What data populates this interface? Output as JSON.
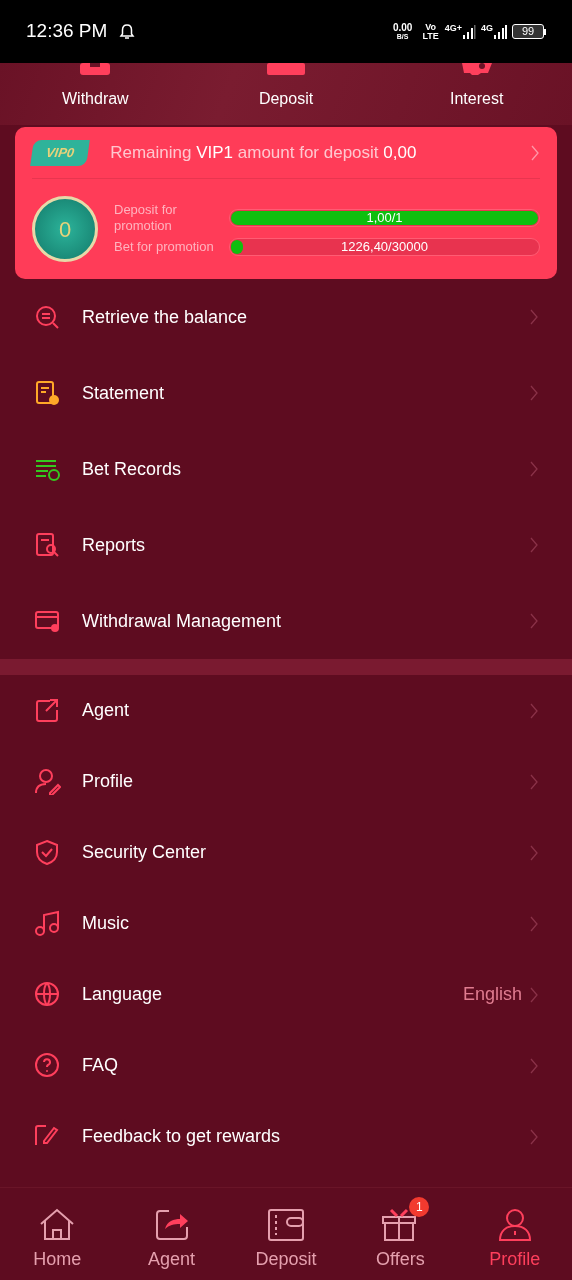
{
  "status_bar": {
    "time": "12:36 PM",
    "speed": "0.00",
    "speed_unit": "B/S",
    "volte_top": "Vo",
    "volte_bottom": "LTE",
    "network_1": "4G+",
    "network_2": "4G",
    "battery": "99"
  },
  "quick_actions": [
    {
      "label": "Withdraw",
      "kind": "withdraw"
    },
    {
      "label": "Deposit",
      "kind": "deposit"
    },
    {
      "label": "Interest",
      "kind": "interest"
    }
  ],
  "vip_card": {
    "badge": "VIP0",
    "message": "Remaining **VIP1**  amount for deposit **0,00**",
    "medal": "0",
    "progress": [
      {
        "label": "Deposit for promotion",
        "reading": "1,00/1",
        "level": 1.0
      },
      {
        "label": "Bet for promotion",
        "reading": "1226,40/30000",
        "level": 0.04
      }
    ]
  },
  "menu_groups": [
    {
      "items": [
        {
          "label": "Retrieve the balance",
          "kind": "retrieve",
          "color": "#ff3f5c"
        },
        {
          "label": "Statement",
          "kind": "statement",
          "color": "#ffa928"
        },
        {
          "label": "Bet Records",
          "kind": "records",
          "color": "#35c81f"
        },
        {
          "label": "Reports",
          "kind": "reports",
          "color": "#ff3f5c"
        },
        {
          "label": "Withdrawal Management",
          "kind": "withdrawal",
          "color": "#ff3f5c"
        }
      ]
    },
    {
      "items": [
        {
          "label": "Agent",
          "kind": "agent",
          "color": "#ff3f5c"
        },
        {
          "label": "Profile",
          "kind": "profile",
          "color": "#ff3f5c"
        },
        {
          "label": "Security Center",
          "kind": "shield",
          "color": "#ff3f5c"
        },
        {
          "label": "Music",
          "kind": "music",
          "color": "#ff3f5c"
        },
        {
          "label": "Language",
          "kind": "globe",
          "color": "#ff3f5c",
          "value": "English"
        },
        {
          "label": "FAQ",
          "kind": "faq",
          "color": "#ff3f5c"
        },
        {
          "label": "Feedback to get rewards",
          "kind": "feedback",
          "color": "#ff3f5c"
        }
      ]
    }
  ],
  "bottom_nav": [
    {
      "label": "Home",
      "kind": "home",
      "selected": false
    },
    {
      "label": "Agent",
      "kind": "agent",
      "selected": false
    },
    {
      "label": "Deposit",
      "kind": "wallet",
      "selected": false
    },
    {
      "label": "Offers",
      "kind": "gift",
      "selected": false,
      "badge": "1"
    },
    {
      "label": "Profile",
      "kind": "profile",
      "selected": true
    }
  ]
}
